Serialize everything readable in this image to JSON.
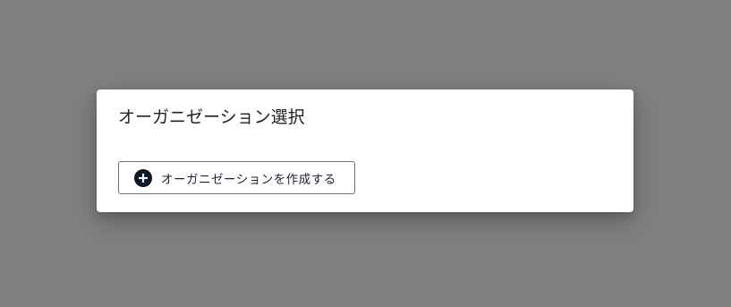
{
  "dialog": {
    "title": "オーガニゼーション選択",
    "create_button": {
      "label": "オーガニゼーションを作成する",
      "icon": "plus-circle-icon"
    }
  },
  "colors": {
    "backdrop": "#808080",
    "dialog_background": "#ffffff",
    "button_border": "#6f6f6f",
    "icon_fill": "#0f1726",
    "text": "#222222"
  }
}
